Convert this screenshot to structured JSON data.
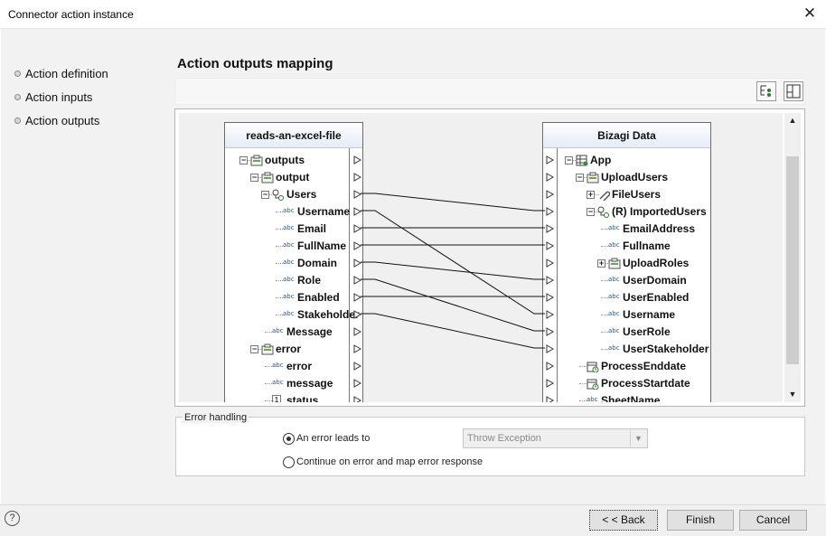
{
  "window": {
    "title": "Connector action instance",
    "close_glyph": "✕"
  },
  "nav": {
    "items": [
      {
        "label": "Action definition"
      },
      {
        "label": "Action inputs"
      },
      {
        "label": "Action outputs"
      }
    ]
  },
  "heading": "Action outputs mapping",
  "toolbar": {
    "tools": [
      {
        "icon": "tree-layout-icon"
      },
      {
        "icon": "resize-panel-icon"
      }
    ]
  },
  "source": {
    "title": "reads-an-excel-file",
    "nodes": [
      {
        "label": "outputs",
        "type": "object"
      },
      {
        "label": "output",
        "type": "object"
      },
      {
        "label": "Users",
        "type": "collection"
      },
      {
        "label": "Username",
        "type": "string"
      },
      {
        "label": "Email",
        "type": "string"
      },
      {
        "label": "FullName",
        "type": "string"
      },
      {
        "label": "Domain",
        "type": "string"
      },
      {
        "label": "Role",
        "type": "string"
      },
      {
        "label": "Enabled",
        "type": "string"
      },
      {
        "label": "Stakeholder",
        "type": "string"
      },
      {
        "label": "Message",
        "type": "string"
      },
      {
        "label": "error",
        "type": "object"
      },
      {
        "label": "error",
        "type": "string"
      },
      {
        "label": "message",
        "type": "string"
      },
      {
        "label": "status",
        "type": "number",
        "type_glyph": "1"
      }
    ]
  },
  "target": {
    "title": "Bizagi Data",
    "nodes": [
      {
        "label": "App",
        "type": "entity"
      },
      {
        "label": "UploadUsers",
        "type": "object"
      },
      {
        "label": "FileUsers",
        "type": "file"
      },
      {
        "label": "(R) ImportedUsers",
        "type": "collection"
      },
      {
        "label": "EmailAddress",
        "type": "string"
      },
      {
        "label": "Fullname",
        "type": "string"
      },
      {
        "label": "UploadRoles",
        "type": "object"
      },
      {
        "label": "UserDomain",
        "type": "string"
      },
      {
        "label": "UserEnabled",
        "type": "string"
      },
      {
        "label": "Username",
        "type": "string"
      },
      {
        "label": "UserRole",
        "type": "string"
      },
      {
        "label": "UserStakeholder",
        "type": "string"
      },
      {
        "label": "ProcessEnddate",
        "type": "date"
      },
      {
        "label": "ProcessStartdate",
        "type": "date"
      },
      {
        "label": "SheetName",
        "type": "string"
      }
    ]
  },
  "type_glyphs": {
    "string": "abc"
  },
  "mappings": [
    {
      "from": "Users",
      "to": "(R) ImportedUsers"
    },
    {
      "from": "Username",
      "to": "Username"
    },
    {
      "from": "Email",
      "to": "EmailAddress"
    },
    {
      "from": "FullName",
      "to": "Fullname"
    },
    {
      "from": "Domain",
      "to": "UserDomain"
    },
    {
      "from": "Role",
      "to": "UserRole"
    },
    {
      "from": "Enabled",
      "to": "UserEnabled"
    },
    {
      "from": "Stakeholder",
      "to": "UserStakeholder"
    }
  ],
  "error_handling": {
    "legend": "Error handling",
    "option_1": "An error leads to",
    "option_2": "Continue on error and map error response",
    "selected_option": 1,
    "select_value": "Throw Exception"
  },
  "footer": {
    "help": "?",
    "back": "< < Back",
    "finish": "Finish",
    "cancel": "Cancel"
  },
  "colors": {
    "accent": "#0078d7",
    "line": "#111111"
  }
}
